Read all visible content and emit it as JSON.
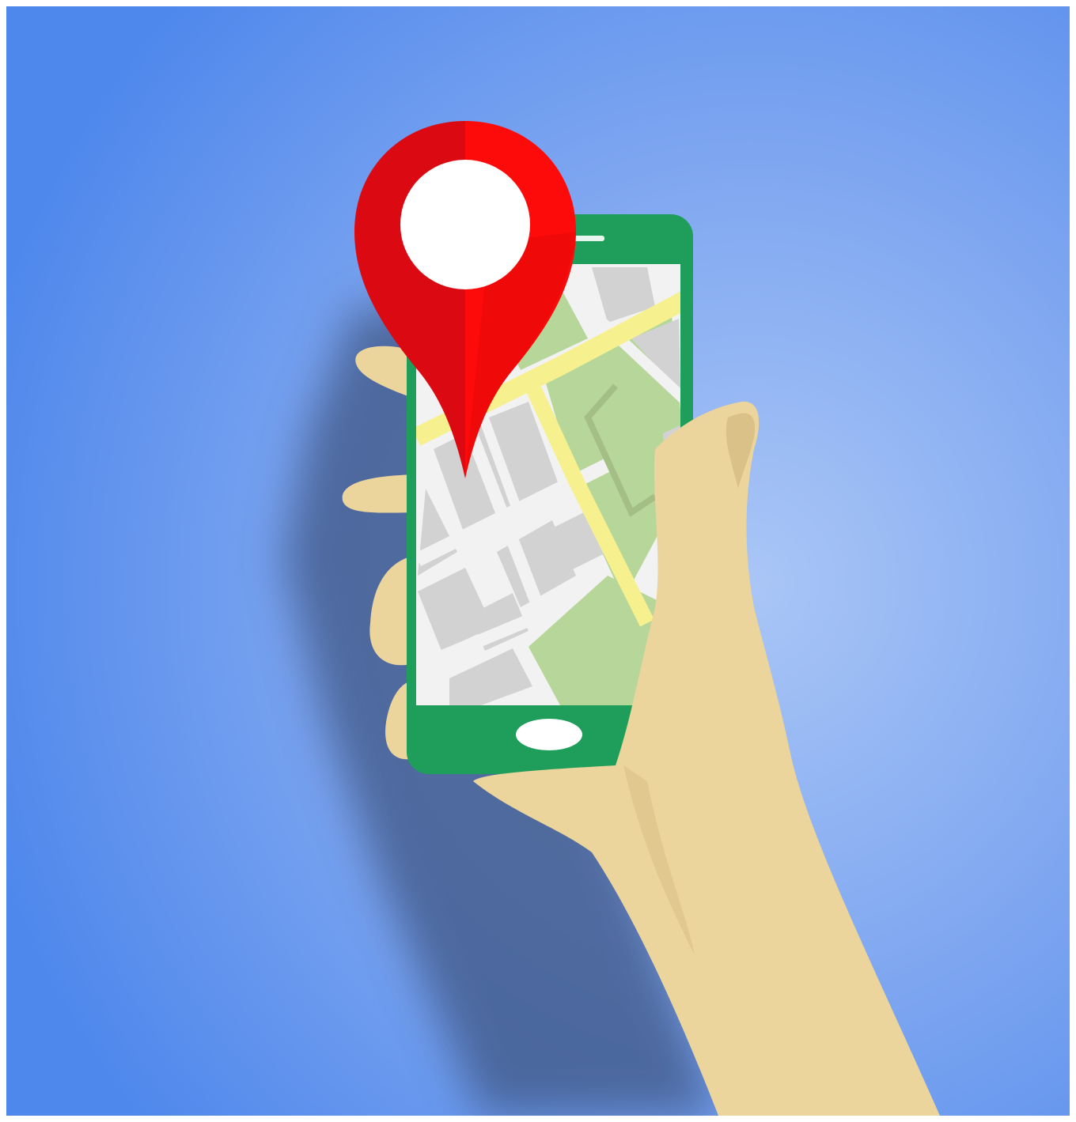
{
  "scene": {
    "subject": "hand-holding-smartphone-with-map-and-location-pin",
    "icons": [
      "location-pin-icon",
      "smartphone-icon",
      "map-icon",
      "hand-icon"
    ],
    "colors": {
      "background_center": "#aac6f6",
      "background_edge": "#4f88ec",
      "phone_body": "#1f9d5a",
      "map_block": "#d2d2d2",
      "map_street": "#f2f2f2",
      "map_road": "#f6f18e",
      "map_park": "#b7d69a",
      "pin_light": "#fd0a0a",
      "pin_dark": "#db0a12",
      "pin_center": "#ffffff",
      "skin": "#ecd59c",
      "skin_shadow": "#d8bf85",
      "shadow": "#3e5583"
    }
  }
}
